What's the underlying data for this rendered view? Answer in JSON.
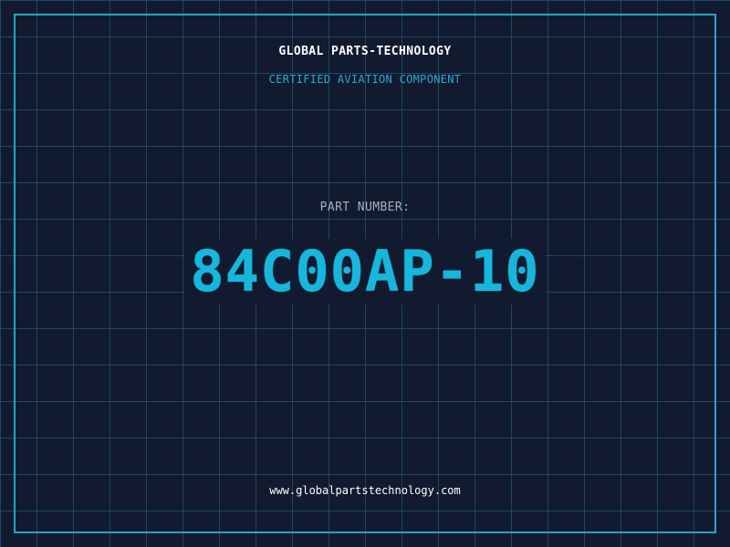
{
  "header": {
    "company": "GLOBAL PARTS-TECHNOLOGY",
    "tagline": "CERTIFIED AVIATION COMPONENT"
  },
  "part": {
    "label": "PART NUMBER:",
    "number": "84C00AP-10"
  },
  "footer": {
    "website": "www.globalpartstechnology.com"
  },
  "colors": {
    "background": "#111a2e",
    "grid": "#286e8c",
    "accent": "#17b6dd",
    "frame": "#29a3c8"
  }
}
